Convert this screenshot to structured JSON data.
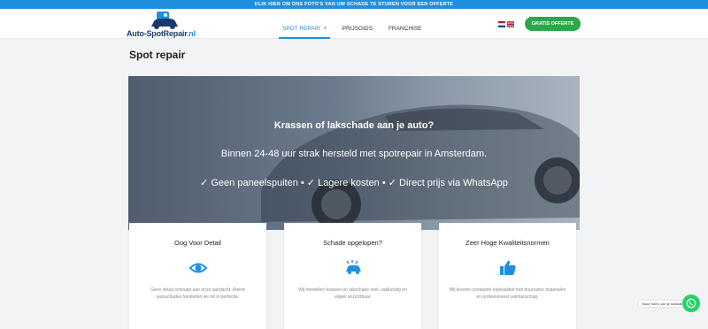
{
  "topbar": {
    "text": "KLIK HIER OM ONS FOTO'S VAN UW SCHADE TE STUREN VOOR EEN OFFERTE"
  },
  "logo": {
    "text_main": "Auto-SpotRepair",
    "text_tld": ".nl"
  },
  "nav": {
    "items": [
      {
        "label": "SPOT REPAIR",
        "caret": "▾"
      },
      {
        "label": "PRIJSGIDS"
      },
      {
        "label": "FRANCHISE"
      }
    ]
  },
  "cta": {
    "label": "GRATIS OFFERTE",
    "color": "#2aa84a"
  },
  "page": {
    "title": "Spot repair"
  },
  "hero": {
    "headline": "Krassen of lakschade aan je auto?",
    "subline": "Binnen 24-48 uur strak hersteld met spotrepair in Amsterdam.",
    "benefits": "✓ Geen paneelspuiten • ✓ Lagere kosten • ✓ Direct prijs via WhatsApp"
  },
  "cards": [
    {
      "title": "Oog Voor Detail",
      "icon": "eye-icon",
      "text": "Geen detail ontsnapt aan onze aandacht. Kleine autoschades herstellen we tot in perfectie."
    },
    {
      "title": "Schade opgelopen?",
      "icon": "car-crash-icon",
      "text": "Wij herstellen krassen en lakschade snel, vakkundig en vrijwel onzichtbaar."
    },
    {
      "title": "Zeer Hoge Kwaliteitsnormen",
      "icon": "thumbs-up-icon",
      "text": "Wij leveren constante topkwaliteit met duurzame materialen en professioneel vakmanschap."
    }
  ],
  "whatsapp": {
    "label": "Stuur foto's van je schade"
  },
  "colors": {
    "accent": "#1f8fe0",
    "cta": "#2aa84a",
    "whatsapp": "#25d366"
  }
}
